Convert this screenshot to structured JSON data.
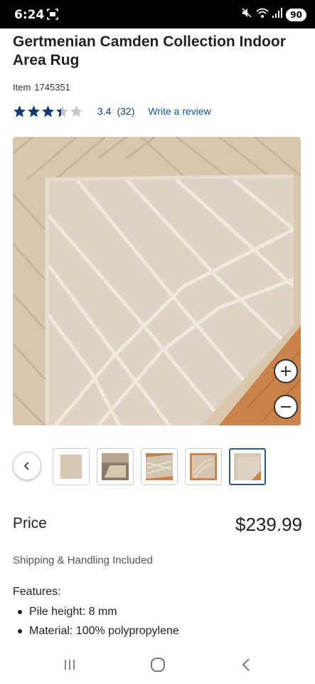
{
  "status_bar": {
    "time": "6:24",
    "battery": "90",
    "icons": [
      "screen-recorder-icon",
      "mute-icon",
      "wifi-icon",
      "signal-icon",
      "battery-icon"
    ]
  },
  "product": {
    "title": "Gertmenian Camden Collection Indoor Area Rug",
    "item_label": "Item",
    "item_number": "1745351",
    "rating": "3.4",
    "rating_value": 3.4,
    "rating_max": 5,
    "review_count": "(32)",
    "write_review": "Write a review"
  },
  "gallery": {
    "thumbnail_count": 5,
    "active_index": 4,
    "thumbnails": [
      "front-view",
      "room-view",
      "corner-view",
      "swirl-view",
      "back-view"
    ]
  },
  "price": {
    "label": "Price",
    "value": "$239.99"
  },
  "shipping": "Shipping & Handling Included",
  "features": {
    "title": "Features:",
    "items": [
      "Pile height: 8 mm",
      "Material: 100% polypropylene"
    ]
  },
  "colors": {
    "star": "#0f3b73",
    "link": "#0f5499",
    "thumb_active_border": "#2a5a8c",
    "rug_beige": "#cfbfa9",
    "floor_wood": "#c9824a"
  }
}
